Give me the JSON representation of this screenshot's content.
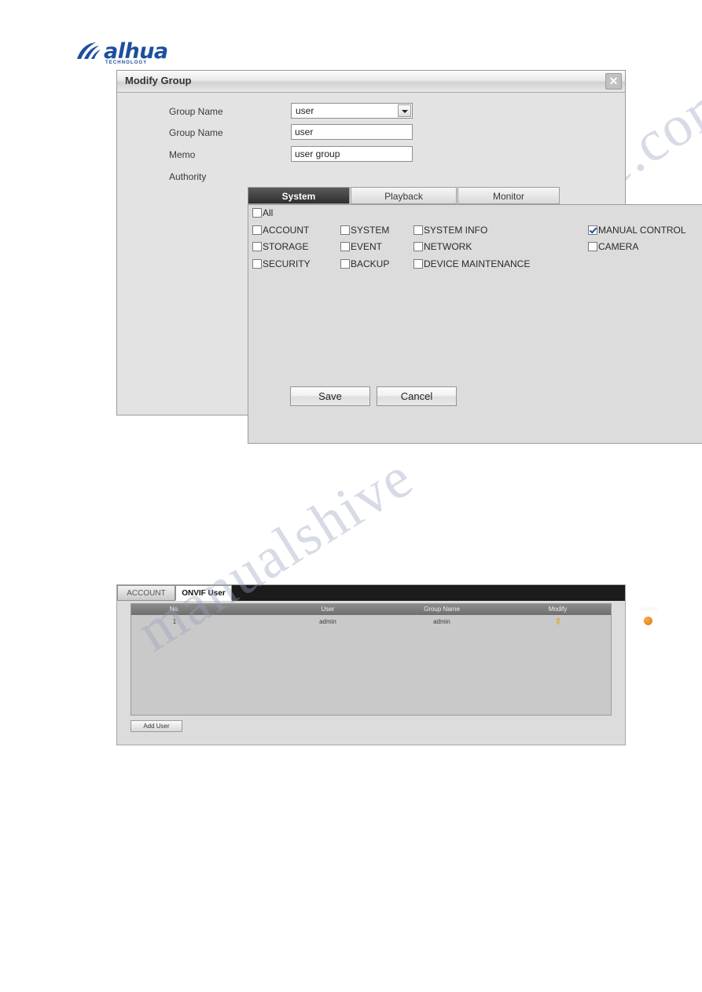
{
  "logo": {
    "brand": "alhua",
    "tagline": "TECHNOLOGY"
  },
  "watermark": {
    "line1": "manualshive.com",
    "line2": "manualshive"
  },
  "dialog": {
    "title": "Modify Group",
    "close_icon": "close-icon",
    "fields": {
      "group_name_select_label": "Group Name",
      "group_name_select_value": "user",
      "group_name_input_label": "Group Name",
      "group_name_input_value": "user",
      "memo_label": "Memo",
      "memo_value": "user group",
      "authority_label": "Authority"
    },
    "tabs": [
      {
        "label": "System",
        "active": true
      },
      {
        "label": "Playback",
        "active": false
      },
      {
        "label": "Monitor",
        "active": false
      }
    ],
    "permissions": {
      "all_label": "All",
      "all_checked": false,
      "items": [
        {
          "label": "ACCOUNT",
          "checked": false
        },
        {
          "label": "SYSTEM",
          "checked": false
        },
        {
          "label": "SYSTEM INFO",
          "checked": false
        },
        {
          "label": "MANUAL CONTROL",
          "checked": true
        },
        {
          "label": "STORAGE",
          "checked": false
        },
        {
          "label": "EVENT",
          "checked": false
        },
        {
          "label": "NETWORK",
          "checked": false
        },
        {
          "label": "CAMERA",
          "checked": false
        },
        {
          "label": "SECURITY",
          "checked": false
        },
        {
          "label": "BACKUP",
          "checked": false
        },
        {
          "label": "DEVICE MAINTENANCE",
          "checked": false
        }
      ]
    },
    "buttons": {
      "save": "Save",
      "cancel": "Cancel"
    }
  },
  "onvif": {
    "tabs": [
      {
        "label": "ACCOUNT",
        "active": false
      },
      {
        "label": "ONVIF User",
        "active": true
      }
    ],
    "columns": [
      "No.",
      "User",
      "Group Name",
      "Modify",
      "Delete"
    ],
    "rows": [
      {
        "no": "1",
        "user": "admin",
        "group_name": "admin",
        "modify_icon": "pencil-icon",
        "delete_icon": "delete-icon"
      }
    ],
    "add_user_button": "Add User"
  }
}
